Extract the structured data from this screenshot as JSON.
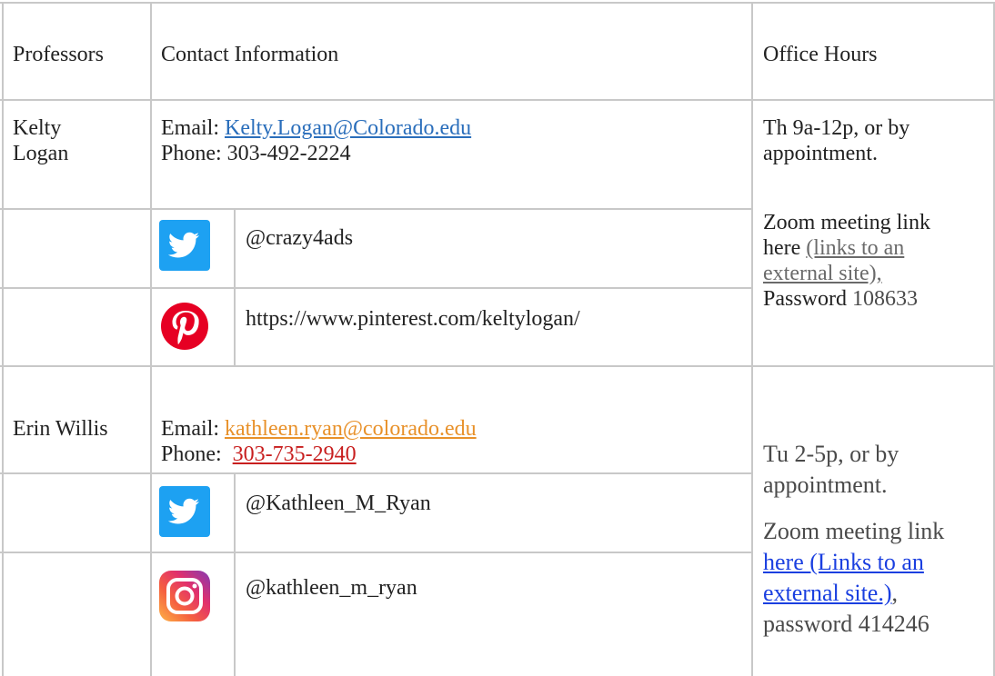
{
  "headers": {
    "professors": "Professors",
    "contact": "Contact Information",
    "office_hours": "Office Hours"
  },
  "kelty": {
    "name_line1": "Kelty",
    "name_line2": "Logan",
    "email_label": "Email: ",
    "email": "Kelty.Logan@Colorado.edu",
    "phone_label": "Phone: ",
    "phone": "303-492-2224",
    "twitter": "@crazy4ads",
    "pinterest": "https://www.pinterest.com/keltylogan/",
    "hours_line1": "Th 9a-12p, or by",
    "hours_line2": "appointment.",
    "zoom_line1": "Zoom meeting link",
    "zoom_here": "here",
    "zoom_link_line1": "(links to an",
    "zoom_link_line2": "external site),",
    "password_label": "Password",
    "password": "108633",
    "twitter_icon": "twitter-icon",
    "pinterest_icon": "pinterest-icon"
  },
  "erin": {
    "name": "Erin Willis",
    "email_label": "Email: ",
    "email": "kathleen.ryan@colorado.edu",
    "phone_label": "Phone:  ",
    "phone": "303-735-2940",
    "twitter": "@Kathleen_M_Ryan",
    "instagram": "@kathleen_m_ryan",
    "hours_line1": "Tu 2-5p, or by",
    "hours_line2": "appointment.",
    "zoom_line1": "Zoom meeting link",
    "zoom_link_line1": "here (Links to an",
    "zoom_link_line2": "external site.)",
    "zoom_link_comma": ",",
    "password_line": "password 414246",
    "twitter_icon": "twitter-icon",
    "instagram_icon": "instagram-icon"
  },
  "colors": {
    "twitter": "#1da1f2",
    "pinterest": "#e60023",
    "border": "#c8c8c8"
  }
}
